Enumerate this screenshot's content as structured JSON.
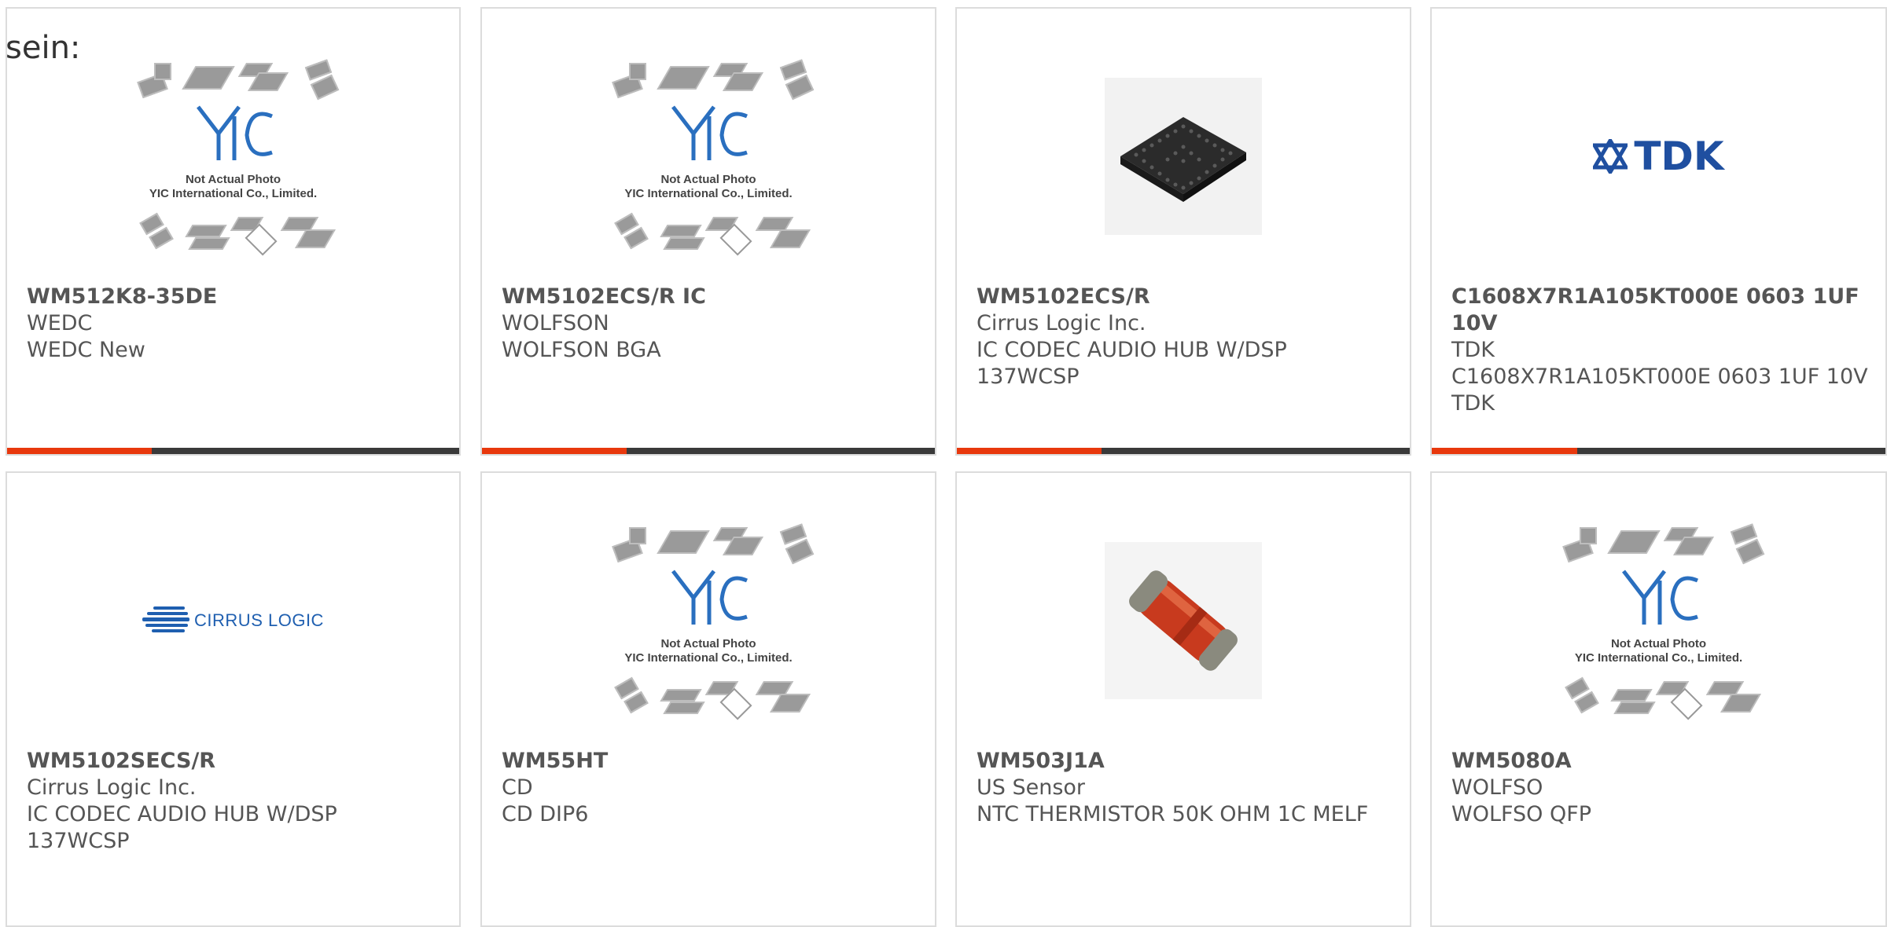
{
  "intro_text": "sein:",
  "products": [
    {
      "part": "WM512K8-35DE",
      "manufacturer": "WEDC",
      "description": "WEDC New",
      "image": "yic-placeholder"
    },
    {
      "part": "WM5102ECS/R IC",
      "manufacturer": "WOLFSON",
      "description": "WOLFSON BGA",
      "image": "yic-placeholder"
    },
    {
      "part": "WM5102ECS/R",
      "manufacturer": "Cirrus Logic Inc.",
      "description": "IC CODEC AUDIO HUB W/DSP 137WCSP",
      "image": "bga-chip-photo"
    },
    {
      "part": "C1608X7R1A105KT000E 0603 1UF 10V",
      "manufacturer": "TDK",
      "description": "C1608X7R1A105KT000E 0603 1UF 10V TDK",
      "image": "tdk-logo"
    },
    {
      "part": "WM5102SECS/R",
      "manufacturer": "Cirrus Logic Inc.",
      "description": "IC CODEC AUDIO HUB W/DSP 137WCSP",
      "image": "cirrus-logic-logo"
    },
    {
      "part": "WM55HT",
      "manufacturer": "CD",
      "description": "CD DIP6",
      "image": "yic-placeholder"
    },
    {
      "part": "WM503J1A",
      "manufacturer": "US Sensor",
      "description": "NTC THERMISTOR 50K OHM 1C MELF",
      "image": "melf-diode-photo"
    },
    {
      "part": "WM5080A",
      "manufacturer": "WOLFSO",
      "description": "WOLFSO QFP",
      "image": "yic-placeholder"
    }
  ],
  "placeholder": {
    "line1": "Not Actual Photo",
    "line2": "YIC International Co., Limited.",
    "logo_text": "YIC"
  },
  "logos": {
    "tdk": "TDK",
    "cirrus": "CIRRUS LOGIC"
  },
  "colors": {
    "accent": "#e8380d",
    "bar": "#3a3a3a",
    "border": "#dcdcdc",
    "text": "#555555"
  }
}
